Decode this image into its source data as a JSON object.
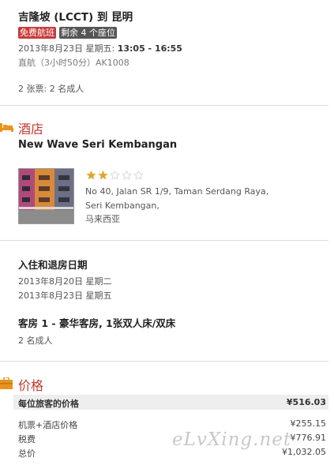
{
  "flight": {
    "route": "吉隆坡 (LCCT) 到 昆明",
    "badge_promo": "免费航班",
    "badge_seats": "剩余 4 个座位",
    "date_prefix": "2013年8月23日 星期五: ",
    "time": "13:05 - 16:55",
    "details": "直航（3小时50分）AK1008",
    "tickets": "2 张票:  2 名成人"
  },
  "hotel": {
    "section_title": "酒店",
    "name": "New Wave Seri Kembangan",
    "rating": 2,
    "rating_max": 5,
    "address_line1": "No 40, Jalan SR 1/9, Taman Serdang Raya,",
    "address_line2": "Seri Kembangan,",
    "country": "马来西亚",
    "dates_title": "入住和退房日期",
    "checkin": "2013年8月20日 星期二",
    "checkout": "2013年8月23日 星期五",
    "room_title": "客房 1 - 豪华客房, 1张双人床/双床",
    "guests": "2 名成人"
  },
  "price": {
    "section_title": "价格",
    "per_person_label": "每位旅客的价格",
    "per_person_value": "¥516.03",
    "rows": [
      {
        "label": "机票+酒店价格",
        "value": "¥255.15"
      },
      {
        "label": "税费",
        "value": "¥776.91"
      },
      {
        "label": "总价",
        "value": "¥1,032.05"
      }
    ]
  },
  "watermark": "eLvXing.net",
  "colors": {
    "accent_red": "#c03a2b",
    "badge_red": "#c83b3b",
    "icon_orange": "#e8931e",
    "star_gold": "#e2a619"
  }
}
